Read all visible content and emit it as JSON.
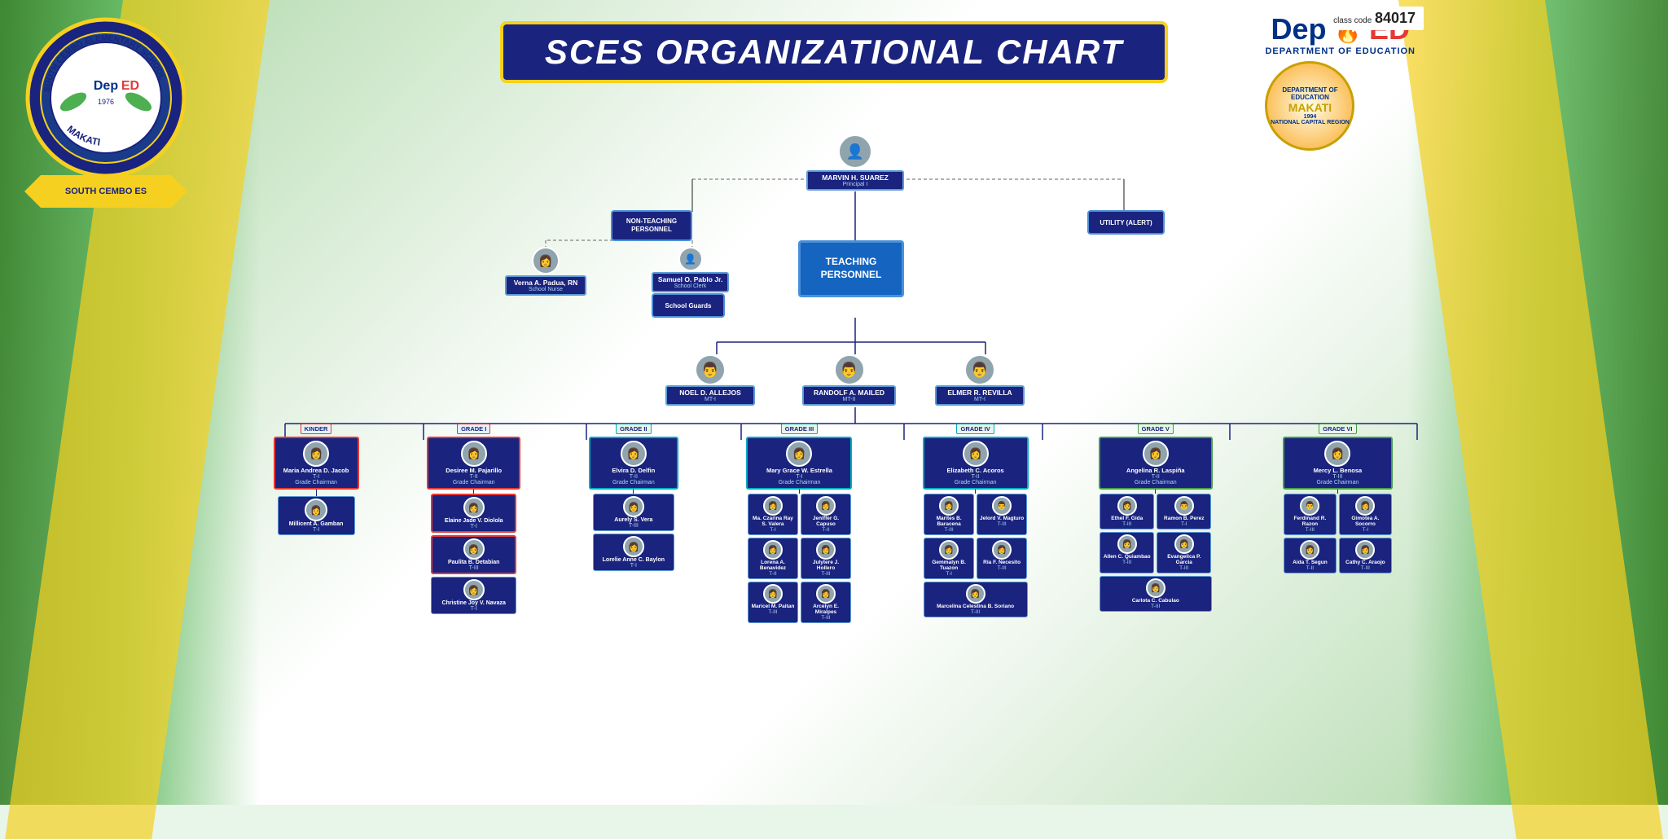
{
  "page": {
    "title": "SCES ORGANIZATIONAL CHART",
    "class_code_label": "class code",
    "class_code": "84017"
  },
  "school": {
    "name": "SOUTH CEMBO ELEMENTARY SCHOOL",
    "location": "MAKATI",
    "year": "1976"
  },
  "deped": {
    "name": "DepED",
    "sub": "DEPARTMENT   OF EDUCATION"
  },
  "principal": {
    "name": "MARVIN H. SUAREZ",
    "role": "Principal I"
  },
  "non_teaching_box": "NON-TEACHING PERSONNEL",
  "utility_box": "UTILITY (ALERT)",
  "teaching_box": "TEACHING\nPERSONNEL",
  "staff": [
    {
      "name": "Verna A. Padua, RN",
      "role": "School Nurse"
    },
    {
      "name": "Samuel O. Pablo Jr.",
      "role": "School Clerk"
    },
    {
      "name": "School Guards",
      "role": ""
    }
  ],
  "mt_teachers": [
    {
      "name": "NOEL D. ALLEJOS",
      "role": "MT-I"
    },
    {
      "name": "RANDOLF A. MAILED",
      "role": "MT-II"
    },
    {
      "name": "ELMER R. REVILLA",
      "role": "MT-I"
    }
  ],
  "grades": [
    {
      "level": "KINDER",
      "chairman": {
        "name": "Maria Andrea D. Jacob",
        "role": "T-I",
        "sub": "Grade Chairman"
      },
      "teachers": [
        {
          "name": "Millicent A. Gamban",
          "role": "T-I"
        }
      ]
    },
    {
      "level": "GRADE I",
      "chairman": {
        "name": "Desiree M. Pajarillo",
        "role": "T-II",
        "sub": "Grade Chairman"
      },
      "teachers": [
        {
          "name": "Elaine Jade V. Diolola",
          "role": "T-I"
        },
        {
          "name": "Paulita B. Detabian",
          "role": "T-III"
        },
        {
          "name": "Christine Joy V. Navaza",
          "role": "T-I"
        }
      ]
    },
    {
      "level": "GRADE II",
      "chairman": {
        "name": "Elvira D. Delfin",
        "role": "T-II",
        "sub": "Grade Chairman"
      },
      "teachers": [
        {
          "name": "Aurely S. Vera",
          "role": "T-III"
        },
        {
          "name": "Lorelie Anne C. Baylon",
          "role": "T-I"
        }
      ]
    },
    {
      "level": "GRADE III",
      "chairman": {
        "name": "Mary Grace W. Estrella",
        "role": "T-I",
        "sub": "Grade Chairman"
      },
      "teachers": [
        {
          "name": "Ma. Czarina Ray S. Valera",
          "role": "T-I"
        },
        {
          "name": "Jeniffer G. Capuso",
          "role": "T-II"
        },
        {
          "name": "Julytere J. Hollero",
          "role": "T-III"
        },
        {
          "name": "Arcelyn E. Miralpes",
          "role": "T-III"
        }
      ]
    },
    {
      "level": "GRADE III (cont)",
      "chairman": null,
      "teachers": [
        {
          "name": "Lorena A. Benavidez",
          "role": "T-II"
        },
        {
          "name": "Maricel M. Paitan",
          "role": "T-III"
        }
      ]
    },
    {
      "level": "GRADE IV",
      "chairman": {
        "name": "Elizabeth C. Acoros",
        "role": "T-II",
        "sub": "Grade Chairman"
      },
      "teachers": [
        {
          "name": "Marites B. Baracena",
          "role": "T-III"
        },
        {
          "name": "Gemmalyn B. Tuazon",
          "role": "T-I"
        },
        {
          "name": "Jelord V. Magturo",
          "role": "T-III"
        },
        {
          "name": "Ria F. Necesito",
          "role": "T-III"
        },
        {
          "name": "Marcelina Celestina B. Soriano",
          "role": "T-III"
        }
      ]
    },
    {
      "level": "GRADE V",
      "chairman": {
        "name": "Angelina R. Laspiña",
        "role": "T-II",
        "sub": "Grade Chairman"
      },
      "teachers": [
        {
          "name": "Ethel F. Gida",
          "role": "T-III"
        },
        {
          "name": "Allen C. Quiambao",
          "role": "T-III"
        },
        {
          "name": "Carlota C. Cabulao",
          "role": "T-III"
        },
        {
          "name": "Ramon B. Perez",
          "role": "T-I"
        },
        {
          "name": "Evangelica P. Garcia",
          "role": "T-III"
        }
      ]
    },
    {
      "level": "GRADE VI",
      "chairman": {
        "name": "Mercy L. Benosa",
        "role": "T-III",
        "sub": "Grade Chairman"
      },
      "teachers": [
        {
          "name": "Ferdinand R. Razon",
          "role": "T-III"
        },
        {
          "name": "Aida T. Segun",
          "role": "T-II"
        },
        {
          "name": "Gimotea A. Socorro",
          "role": "T-I"
        },
        {
          "name": "Cathy C. Araojo",
          "role": "T-III"
        }
      ]
    }
  ]
}
